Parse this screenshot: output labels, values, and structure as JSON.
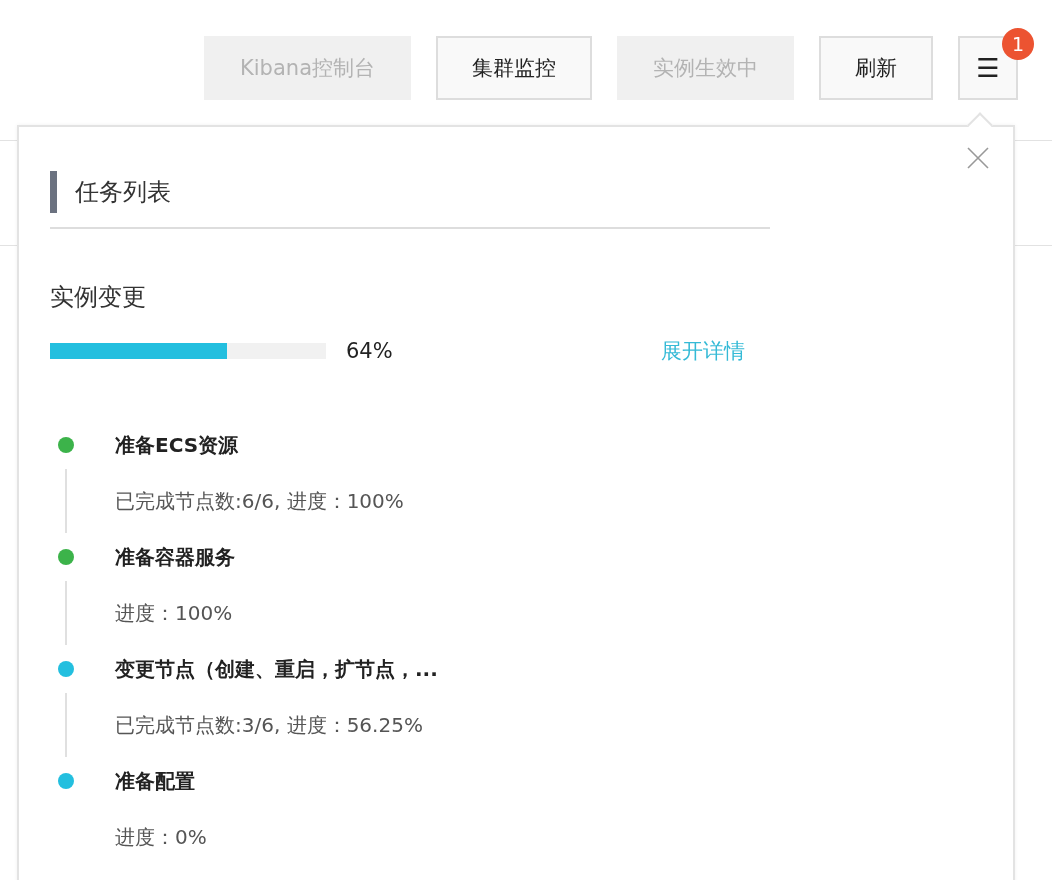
{
  "toolbar": {
    "buttons": [
      {
        "label": "Kibana控制台",
        "disabled": true
      },
      {
        "label": "集群监控",
        "disabled": false
      },
      {
        "label": "实例生效中",
        "disabled": true
      },
      {
        "label": "刷新",
        "disabled": false
      }
    ],
    "menu_button": {
      "label": "☰",
      "badge": "1"
    }
  },
  "panel": {
    "title": "任务列表",
    "section": "实例变更",
    "progress": {
      "level": 0.64,
      "reading": "64%"
    },
    "details_link": "展开详情",
    "tasks": [
      {
        "title": "准备ECS资源",
        "detail": "已完成节点数:6/6, 进度：100%",
        "color": "#3cb34a"
      },
      {
        "title": "准备容器服务",
        "detail": "进度：100%",
        "color": "#3cb34a"
      },
      {
        "title": "变更节点（创建、重启，扩节点，...",
        "detail": "已完成节点数:3/6, 进度：56.25%",
        "color": "#23bfdf"
      },
      {
        "title": "准备配置",
        "detail": "进度：0%",
        "color": "#23bfdf"
      }
    ]
  }
}
